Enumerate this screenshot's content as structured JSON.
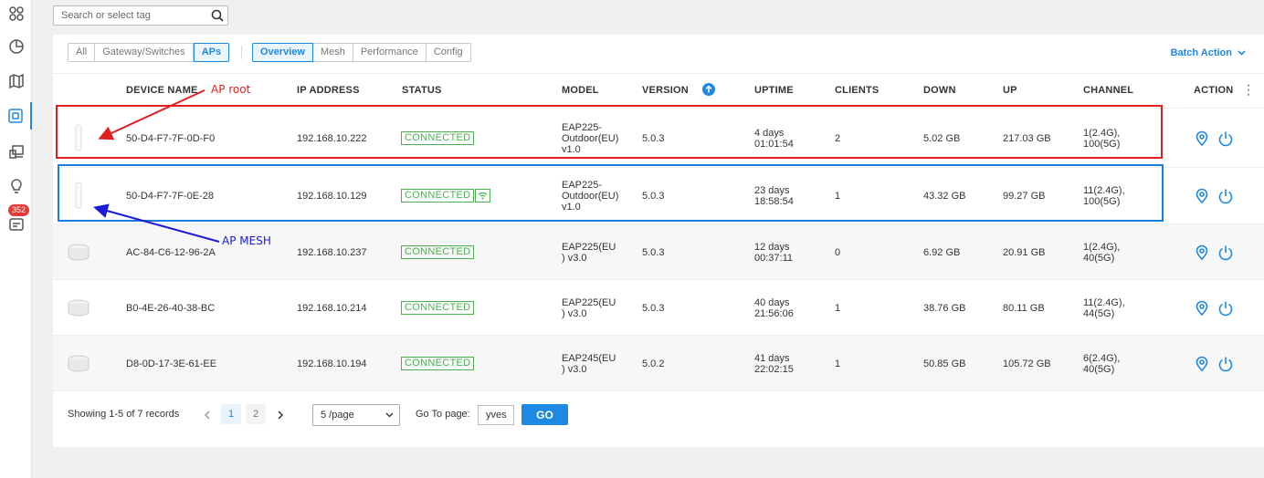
{
  "sidebar": {
    "badge_count": "352"
  },
  "search": {
    "placeholder": "Search or select tag"
  },
  "filters": {
    "device_types": [
      "All",
      "Gateway/Switches",
      "APs"
    ],
    "views": [
      "Overview",
      "Mesh",
      "Performance",
      "Config"
    ]
  },
  "batch_action": "Batch Action",
  "columns": {
    "device_name": "DEVICE NAME",
    "ip": "IP ADDRESS",
    "status": "STATUS",
    "model": "MODEL",
    "version": "VERSION",
    "uptime": "UPTIME",
    "clients": "CLIENTS",
    "down": "DOWN",
    "up": "UP",
    "channel": "CHANNEL",
    "action": "ACTION"
  },
  "rows": [
    {
      "name": "50-D4-F7-7F-0D-F0",
      "ip": "192.168.10.222",
      "status": "CONNECTED",
      "model_1": "EAP225-",
      "model_2": "Outdoor(EU)",
      "model_3": "v1.0",
      "version": "5.0.3",
      "uptime_1": "4 days",
      "uptime_2": "01:01:54",
      "clients": "2",
      "down": "5.02 GB",
      "up": "217.03 GB",
      "channel_1": "1(2.4G),",
      "channel_2": "100(5G)"
    },
    {
      "name": "50-D4-F7-7F-0E-28",
      "ip": "192.168.10.129",
      "status": "CONNECTED",
      "model_1": "EAP225-",
      "model_2": "Outdoor(EU)",
      "model_3": "v1.0",
      "version": "5.0.3",
      "uptime_1": "23 days",
      "uptime_2": "18:58:54",
      "clients": "1",
      "down": "43.32 GB",
      "up": "99.27 GB",
      "channel_1": "11(2.4G),",
      "channel_2": "100(5G)"
    },
    {
      "name": "AC-84-C6-12-96-2A",
      "ip": "192.168.10.237",
      "status": "CONNECTED",
      "model_1": "EAP225(EU",
      "model_2": ") v3.0",
      "model_3": "",
      "version": "5.0.3",
      "uptime_1": "12 days",
      "uptime_2": "00:37:11",
      "clients": "0",
      "down": "6.92 GB",
      "up": "20.91 GB",
      "channel_1": "1(2.4G),",
      "channel_2": "40(5G)"
    },
    {
      "name": "B0-4E-26-40-38-BC",
      "ip": "192.168.10.214",
      "status": "CONNECTED",
      "model_1": "EAP225(EU",
      "model_2": ") v3.0",
      "model_3": "",
      "version": "5.0.3",
      "uptime_1": "40 days",
      "uptime_2": "21:56:06",
      "clients": "1",
      "down": "38.76 GB",
      "up": "80.11 GB",
      "channel_1": "11(2.4G),",
      "channel_2": "44(5G)"
    },
    {
      "name": "D8-0D-17-3E-61-EE",
      "ip": "192.168.10.194",
      "status": "CONNECTED",
      "model_1": "EAP245(EU",
      "model_2": ") v3.0",
      "model_3": "",
      "version": "5.0.2",
      "uptime_1": "41 days",
      "uptime_2": "22:02:15",
      "clients": "1",
      "down": "50.85 GB",
      "up": "105.72 GB",
      "channel_1": "6(2.4G),",
      "channel_2": "40(5G)"
    }
  ],
  "pagination": {
    "showing": "Showing 1-5 of 7 records",
    "pages": [
      "1",
      "2"
    ],
    "per_page": "5 /page",
    "goto_label": "Go To page:",
    "goto_value": "yves",
    "go": "GO"
  },
  "annotations": {
    "root_label": "AP root",
    "mesh_label": "AP MESH",
    "root_color": "#e21f1f",
    "mesh_color": "#1a7be0"
  }
}
